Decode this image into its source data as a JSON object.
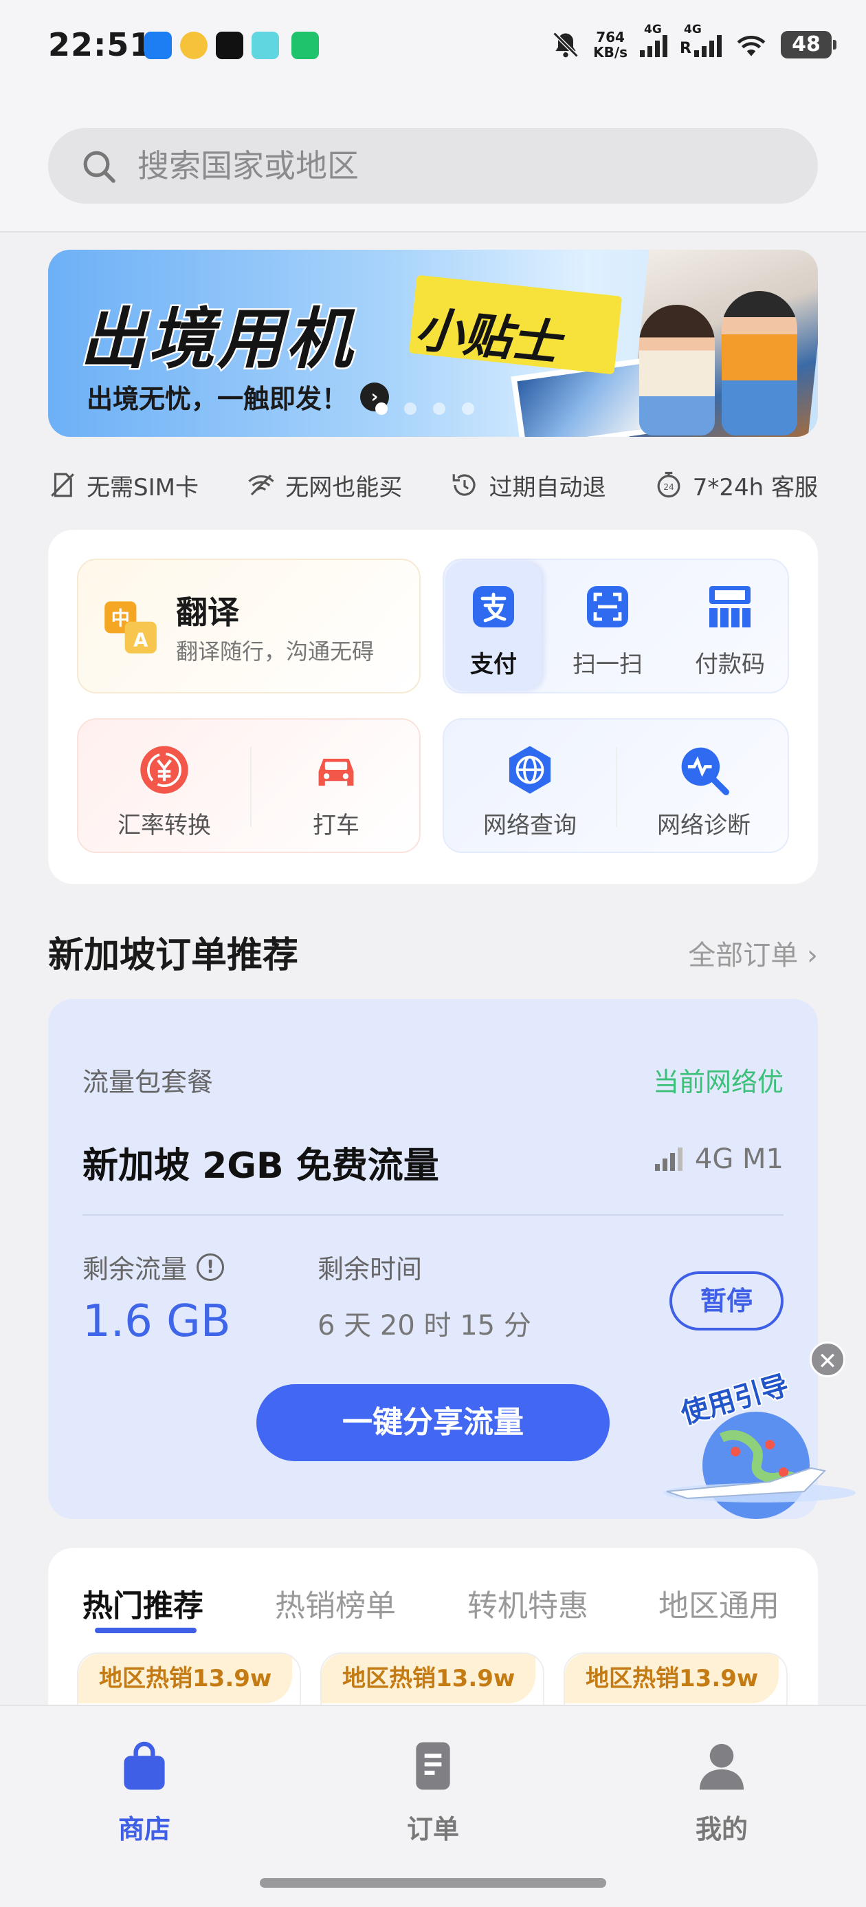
{
  "status_bar": {
    "time": "22:51",
    "net_speed_value": "764",
    "net_speed_unit": "KB/s",
    "sim1_label": "4G",
    "sim2_label": "4G",
    "sim2_roaming": "R",
    "battery": "48",
    "app_icons": [
      "maps-icon",
      "weibo-icon",
      "tiktok-icon",
      "message-icon",
      "chat-icon"
    ]
  },
  "search": {
    "placeholder": "搜索国家或地区"
  },
  "banner": {
    "title": "出境用机",
    "tag": "小贴士",
    "subtitle": "出境无忧，一触即发！",
    "page_count": 4,
    "active_page": 1
  },
  "features": [
    {
      "icon": "no-sim-icon",
      "label": "无需SIM卡"
    },
    {
      "icon": "no-network-icon",
      "label": "无网也能买"
    },
    {
      "icon": "history-refund-icon",
      "label": "过期自动退"
    },
    {
      "icon": "24h-service-icon",
      "label": "7*24h 客服"
    }
  ],
  "tools": {
    "translate": {
      "title": "翻译",
      "subtitle": "翻译随行，沟通无碍",
      "icon": "translate-icon"
    },
    "payment": [
      {
        "label": "支付",
        "icon": "alipay-icon",
        "selected": true
      },
      {
        "label": "扫一扫",
        "icon": "scan-icon",
        "selected": false
      },
      {
        "label": "付款码",
        "icon": "payment-code-icon",
        "selected": false
      }
    ],
    "exchange": {
      "label": "汇率转换",
      "icon": "exchange-rate-icon"
    },
    "taxi": {
      "label": "打车",
      "icon": "car-icon"
    },
    "net_query": {
      "label": "网络查询",
      "icon": "globe-icon"
    },
    "net_diag": {
      "label": "网络诊断",
      "icon": "diagnose-icon"
    }
  },
  "section": {
    "title": "新加坡订单推荐",
    "all_orders": "全部订单"
  },
  "order": {
    "type": "流量包套餐",
    "network_status": "当前网络优",
    "name": "新加坡 2GB 免费流量",
    "network": "4G M1",
    "remaining_label": "剩余流量",
    "remaining_value": "1.6 GB",
    "time_label": "剩余时间",
    "time_value": "6 天 20 时 15 分",
    "pause": "暂停",
    "share": "一键分享流量"
  },
  "guide": {
    "label": "使用引导"
  },
  "tabs": {
    "items": [
      "热门推荐",
      "热销榜单",
      "转机特惠",
      "地区通用"
    ],
    "active": 0
  },
  "chips": [
    "地区热销13.9w",
    "地区热销13.9w",
    "地区热销13.9w"
  ],
  "bottom_nav": [
    {
      "label": "商店",
      "icon": "shopping-bag-icon",
      "active": true
    },
    {
      "label": "订单",
      "icon": "document-icon",
      "active": false
    },
    {
      "label": "我的",
      "icon": "person-icon",
      "active": false
    }
  ],
  "colors": {
    "accent": "#3f5fe6",
    "good": "#3cc07a",
    "card_bg": "#e2e9fd"
  }
}
